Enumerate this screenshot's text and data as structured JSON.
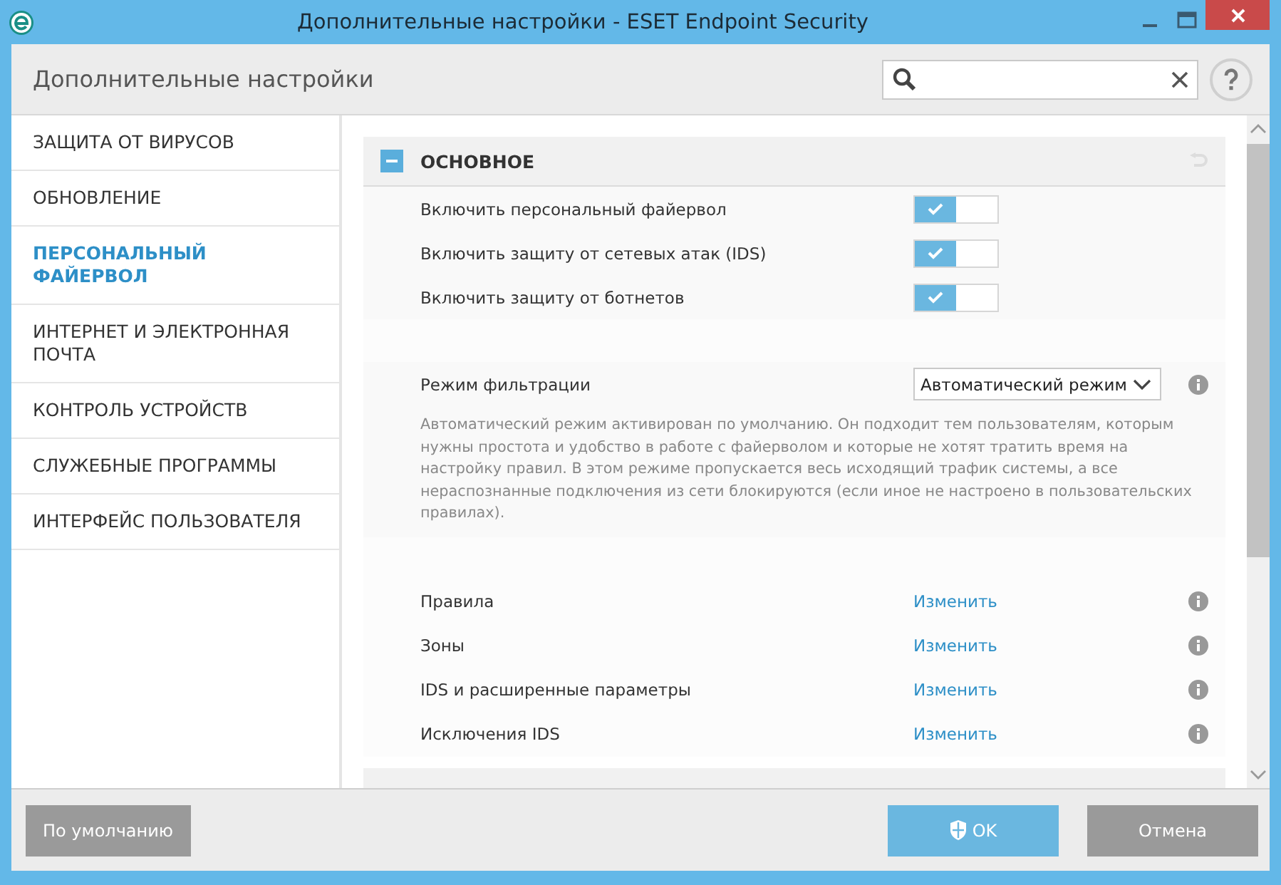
{
  "window": {
    "title": "Дополнительные настройки - ESET Endpoint Security"
  },
  "header": {
    "title": "Дополнительные настройки"
  },
  "sidebar": {
    "items": [
      {
        "label": "ЗАЩИТА ОТ ВИРУСОВ",
        "selected": false
      },
      {
        "label": "ОБНОВЛЕНИЕ",
        "selected": false
      },
      {
        "label": "ПЕРСОНАЛЬНЫЙ ФАЙЕРВОЛ",
        "selected": true
      },
      {
        "label": "ИНТЕРНЕТ И ЭЛЕКТРОННАЯ ПОЧТА",
        "selected": false
      },
      {
        "label": "КОНТРОЛЬ УСТРОЙСТВ",
        "selected": false
      },
      {
        "label": "СЛУЖЕБНЫЕ ПРОГРАММЫ",
        "selected": false
      },
      {
        "label": "ИНТЕРФЕЙС ПОЛЬЗОВАТЕЛЯ",
        "selected": false
      }
    ]
  },
  "section": {
    "title": "ОСНОВНОЕ",
    "expanded": true,
    "rows": [
      {
        "kind": "toggle",
        "label": "Включить персональный файервол",
        "on": true
      },
      {
        "kind": "toggle",
        "label": "Включить защиту от сетевых атак (IDS)",
        "on": true
      },
      {
        "kind": "toggle",
        "label": "Включить защиту от ботнетов",
        "on": true
      },
      {
        "kind": "spacer"
      },
      {
        "kind": "select",
        "label": "Режим фильтрации",
        "value": "Автоматический режим"
      },
      {
        "kind": "description",
        "text": "Автоматический режим активирован по умолчанию. Он подходит тем пользователям, которым нужны простота и удобство в работе с файерволом и которые не хотят тратить время на настройку правил. В этом режиме пропускается весь исходящий трафик системы, а все нераспознанные подключения из сети блокируются (если иное не настроено в пользовательских правилах)."
      },
      {
        "kind": "spacer"
      },
      {
        "kind": "link",
        "label": "Правила",
        "link": "Изменить"
      },
      {
        "kind": "link",
        "label": "Зоны",
        "link": "Изменить"
      },
      {
        "kind": "link",
        "label": "IDS и расширенные параметры",
        "link": "Изменить"
      },
      {
        "kind": "link",
        "label": "Исключения IDS",
        "link": "Изменить"
      }
    ]
  },
  "footer": {
    "default_button": "По умолчанию",
    "ok_button": "OK",
    "cancel_button": "Отмена"
  }
}
